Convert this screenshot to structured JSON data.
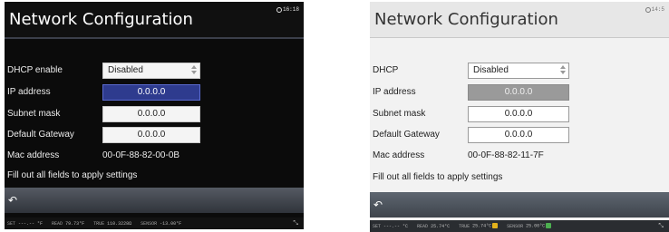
{
  "screens": [
    {
      "title": "Network Configuration",
      "clock": "16:18",
      "rows": [
        {
          "label": "DHCP enable",
          "value": "Disabled",
          "kind": "select"
        },
        {
          "label": "IP address",
          "value": "0.0.0.0",
          "kind": "input",
          "active": true
        },
        {
          "label": "Subnet mask",
          "value": "0.0.0.0",
          "kind": "input"
        },
        {
          "label": "Default Gateway",
          "value": "0.0.0.0",
          "kind": "input"
        },
        {
          "label": "Mac address",
          "value": "00-0F-88-82-00-0B",
          "kind": "text"
        }
      ],
      "message": "Fill out all fields to apply settings",
      "back_icon": "↶",
      "status": [
        {
          "k": "SET",
          "v": "---.-- °F"
        },
        {
          "k": "READ",
          "v": "79.73°F"
        },
        {
          "k": "TRUE",
          "v": "110.3228Ω"
        },
        {
          "k": "SENSOR",
          "v": "-13.00°F"
        }
      ],
      "status_icon": "⤡"
    },
    {
      "title": "Network Configuration",
      "clock": "14:5",
      "rows": [
        {
          "label": "DHCP",
          "value": "Disabled",
          "kind": "select"
        },
        {
          "label": "IP address",
          "value": "0.0.0.0",
          "kind": "input",
          "active": true
        },
        {
          "label": "Subnet mask",
          "value": "0.0.0.0",
          "kind": "input"
        },
        {
          "label": "Default Gateway",
          "value": "0.0.0.0",
          "kind": "input"
        },
        {
          "label": "Mac address",
          "value": "00-0F-88-82-11-7F",
          "kind": "text"
        }
      ],
      "message": "Fill out all fields to apply settings",
      "back_icon": "↶",
      "status": [
        {
          "k": "SET",
          "v": "---.-- °C"
        },
        {
          "k": "READ",
          "v": "25.74°C"
        },
        {
          "k": "TRUE",
          "v": "25.74°C",
          "chk": "#e3b21c"
        },
        {
          "k": "SENSOR",
          "v": "25.00°C",
          "chk": "#4caf50"
        }
      ],
      "status_icon": "⤡"
    }
  ]
}
